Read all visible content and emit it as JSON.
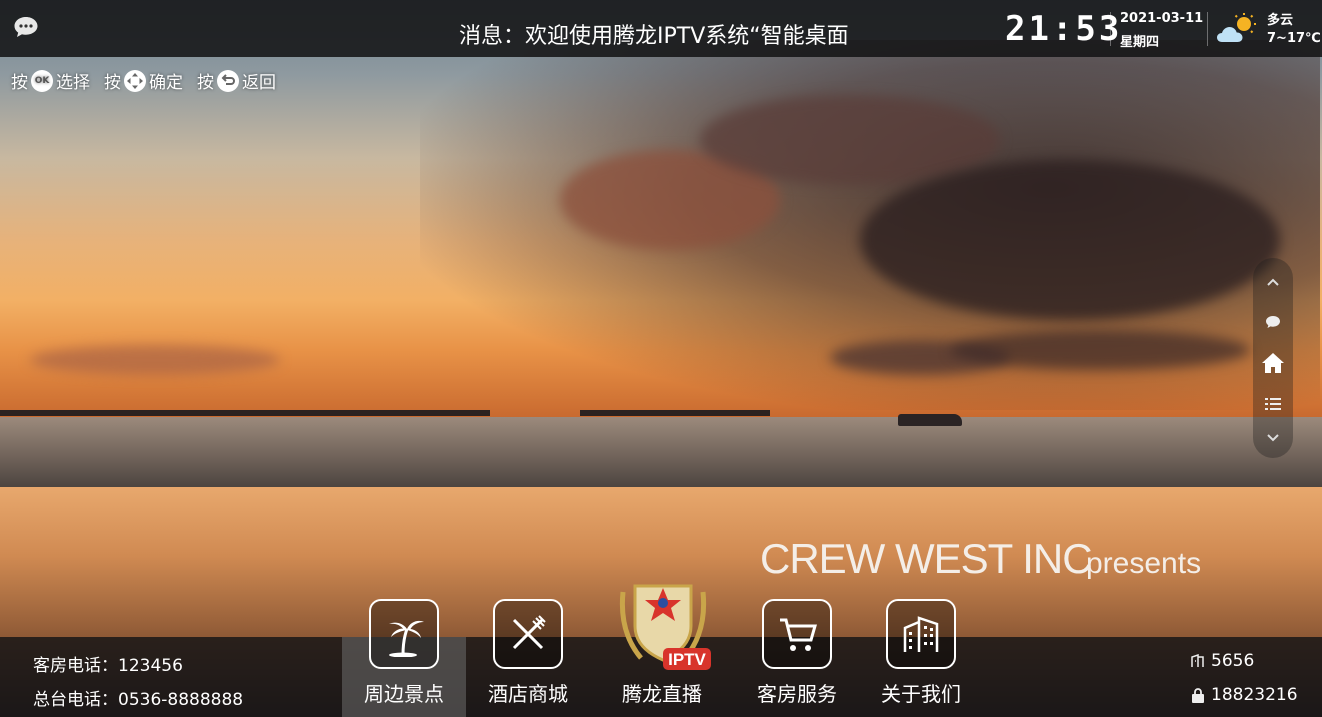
{
  "topbar": {
    "message": "消息：欢迎使用腾龙IPTV系统“智能桌面",
    "clock": "21:53",
    "date": "2021-03-11",
    "weekday": "星期四",
    "weather": {
      "desc": "多云",
      "temp": "7~17℃",
      "icon": "partly-cloudy-icon"
    }
  },
  "hint": {
    "press1": "按",
    "key1": "OK",
    "action1": "选择",
    "press2": "按",
    "action2": "确定",
    "press3": "按",
    "action3": "返回"
  },
  "brand": {
    "name": "CREW WEST INC",
    "sub": "presents"
  },
  "left_info": {
    "room_phone": "客房电话：123456",
    "desk_phone": "总台电话：0536-8888888"
  },
  "right_info": {
    "room_no": "5656",
    "account": "18823216"
  },
  "nav": [
    {
      "label": "周边景点",
      "icon": "palm-tree-icon",
      "active": true
    },
    {
      "label": "酒店商城",
      "icon": "fork-knife-icon",
      "active": false
    },
    {
      "label": "腾龙直播",
      "icon": "iptv-logo",
      "active": false,
      "badge": "IPTV"
    },
    {
      "label": "客房服务",
      "icon": "cart-icon",
      "active": false
    },
    {
      "label": "关于我们",
      "icon": "building-icon",
      "active": false
    }
  ],
  "side_rail": [
    "chevron-up-icon",
    "chat-icon",
    "home-icon",
    "list-icon",
    "chevron-down-icon"
  ],
  "colors": {
    "accent_red": "#d8342b",
    "gold": "#c9a54a"
  }
}
